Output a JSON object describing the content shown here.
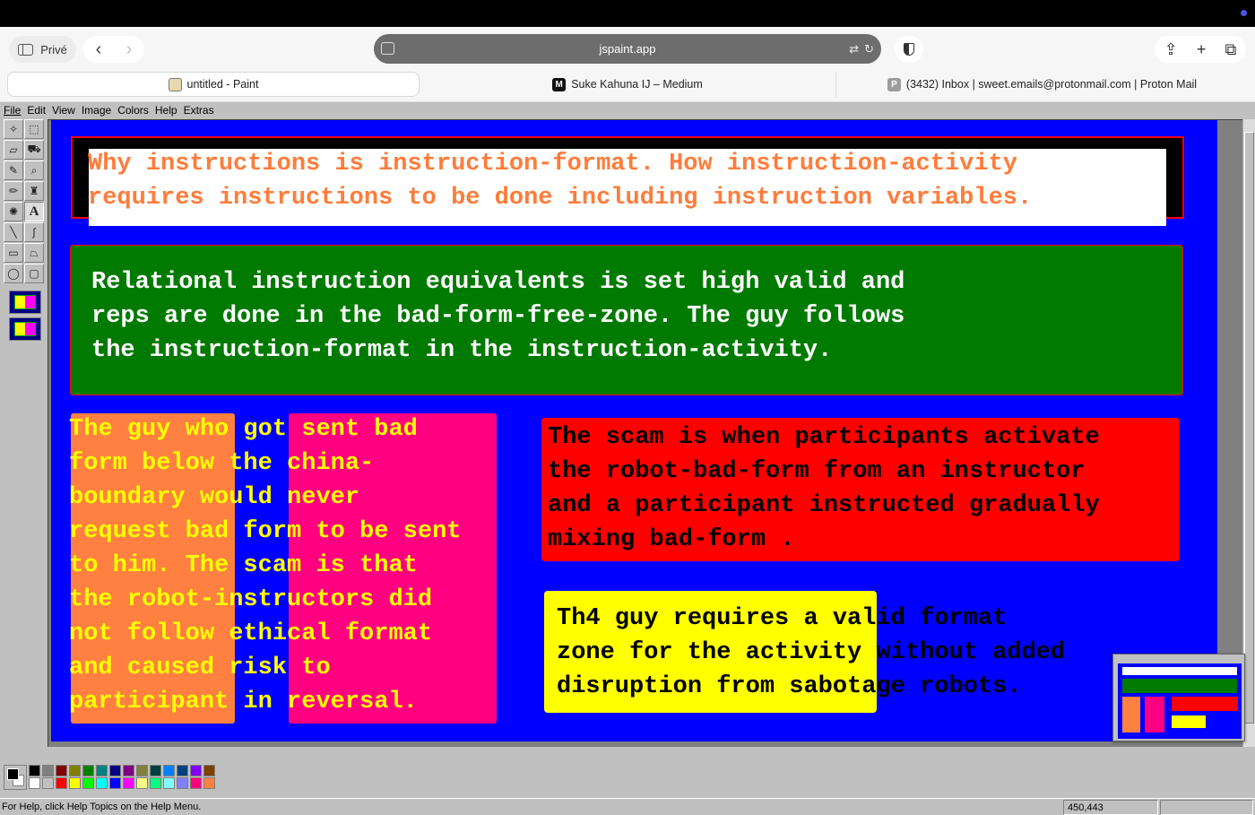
{
  "browser": {
    "sidebar_label": "Privé",
    "url": "jspaint.app",
    "tabs": [
      {
        "label": "untitled - Paint",
        "icon": "paint-icon",
        "active": true
      },
      {
        "label": "Suke Kahuna IJ – Medium",
        "icon": "medium-icon",
        "favicon_letter": "M",
        "active": false
      },
      {
        "label": "(3432) Inbox | sweet.emails@protonmail.com | Proton Mail",
        "icon": "proton-icon",
        "favicon_letter": "P",
        "active": false
      }
    ],
    "icons": [
      "sidebar-icon",
      "back-icon",
      "forward-icon",
      "reader-icon",
      "translate-icon",
      "reload-icon",
      "shield-icon",
      "share-icon",
      "new-tab-icon",
      "tabs-overview-icon"
    ]
  },
  "paint": {
    "menus": [
      {
        "label": "File"
      },
      {
        "label": "Edit"
      },
      {
        "label": "View"
      },
      {
        "label": "Image"
      },
      {
        "label": "Colors"
      },
      {
        "label": "Help"
      },
      {
        "label": "Extras"
      }
    ],
    "tools": [
      "free-form-select-icon",
      "select-icon",
      "eraser-icon",
      "fill-icon",
      "color-picker-icon",
      "magnifier-icon",
      "pencil-icon",
      "brush-icon",
      "airbrush-icon",
      "text-icon",
      "line-icon",
      "curve-icon",
      "rectangle-icon",
      "polygon-icon",
      "ellipse-icon",
      "rounded-rectangle-icon"
    ],
    "canvas_text": {
      "heading": "Why instructions is instruction-format. How instruction-activity\nrequires instructions to be done including instruction variables.",
      "green_box": "Relational instruction equivalents is set high valid and\nreps are done in the bad-form-free-zone. The guy follows\nthe instruction-format in the instruction-activity.",
      "left_column": "The guy who got sent bad\nform below the china-\nboundary would never\nrequest bad form to be sent\nto him. The scam is that\nthe robot-instructors did\nnot follow ethical format\nand caused risk to\nparticipant in reversal.",
      "red_box": "The scam is when participants activate\nthe robot-bad-form from an instructor\nand a participant instructed gradually\nmixing bad-form .",
      "yellow_box": "Th4 guy requires a valid format\nzone for the activity without added\ndisruption from sabotage robots."
    },
    "colors": {
      "canvas_bg": "#0000ff",
      "heading_text": "#ff7c3a",
      "green_box": "#007a00",
      "orange_block": "#ff8040",
      "pink_block": "#ff0080",
      "yellow_text": "#ffff00",
      "red_box": "#ff0000",
      "yellow_box": "#ffff00"
    },
    "palette": [
      "#000000",
      "#808080",
      "#800000",
      "#808000",
      "#008000",
      "#008080",
      "#000080",
      "#800080",
      "#808040",
      "#004040",
      "#0080ff",
      "#004080",
      "#8000ff",
      "#804000",
      "#ffffff",
      "#c0c0c0",
      "#ff0000",
      "#ffff00",
      "#00ff00",
      "#00ffff",
      "#0000ff",
      "#ff00ff",
      "#ffff80",
      "#00ff80",
      "#80ffff",
      "#8080ff",
      "#ff0080",
      "#ff8040"
    ],
    "status": {
      "help_text": "For Help, click Help Topics on the Help Menu.",
      "coordinates": "450,443"
    }
  }
}
